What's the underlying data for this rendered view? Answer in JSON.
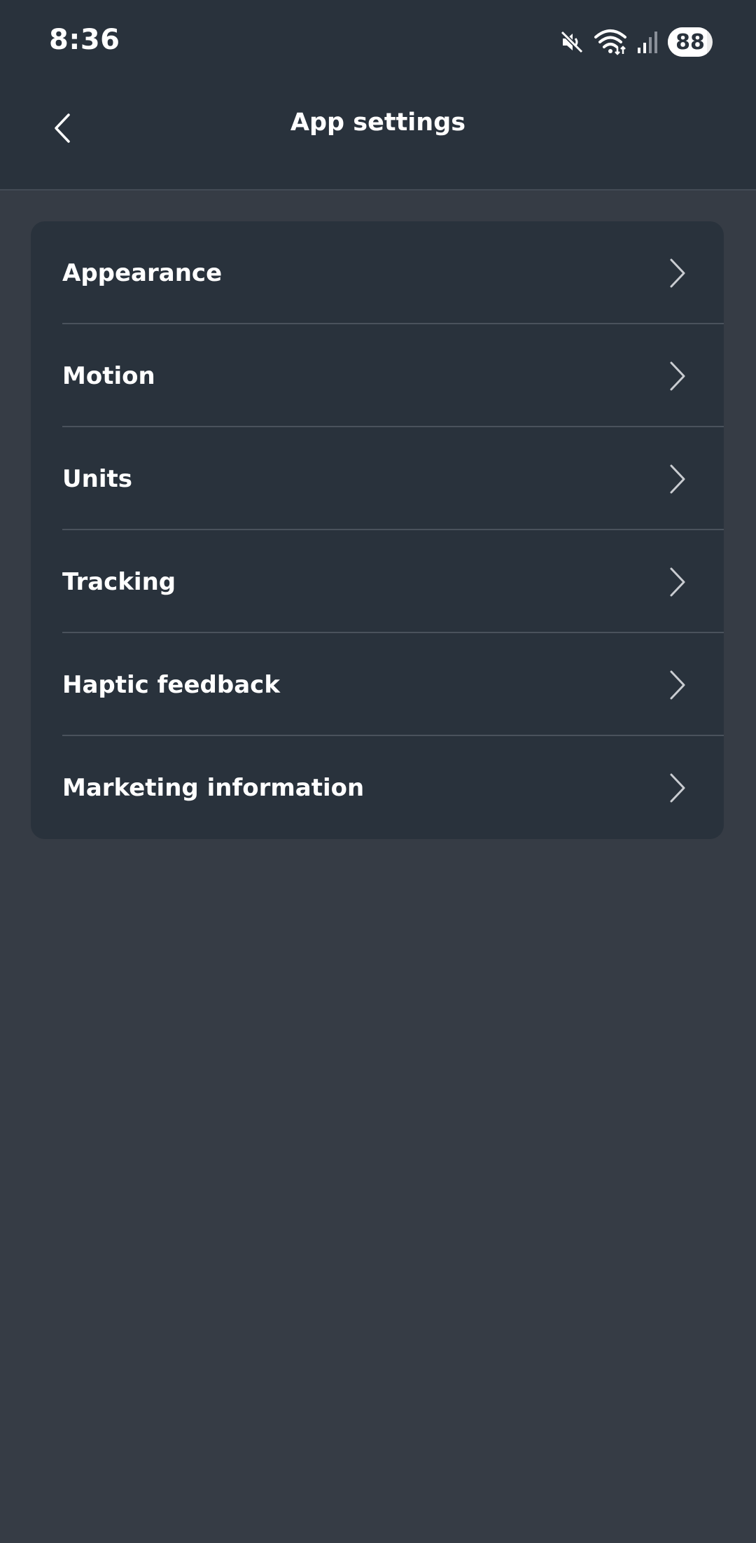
{
  "status_bar": {
    "time": "8:36",
    "battery_level": "88",
    "icons": [
      "mute-icon",
      "wifi-icon",
      "signal-icon",
      "battery-icon"
    ]
  },
  "header": {
    "title": "App settings",
    "back_icon": "chevron-left-icon"
  },
  "settings": {
    "items": [
      {
        "label": "Appearance"
      },
      {
        "label": "Motion"
      },
      {
        "label": "Units"
      },
      {
        "label": "Tracking"
      },
      {
        "label": "Haptic feedback"
      },
      {
        "label": "Marketing information"
      }
    ]
  },
  "colors": {
    "header_bg": "#29323c",
    "page_bg": "#363c45",
    "card_bg": "#29323c",
    "divider": "#4a525c",
    "text": "#ffffff"
  }
}
